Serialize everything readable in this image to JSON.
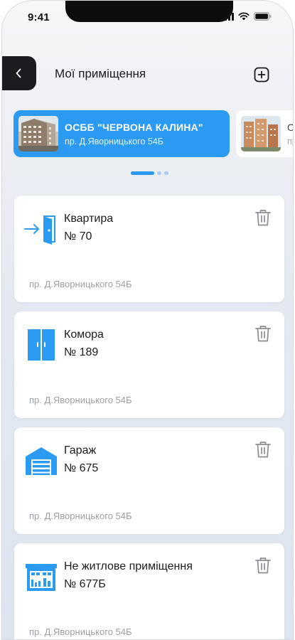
{
  "status_bar": {
    "time": "9:41"
  },
  "header": {
    "title": "Мої приміщення"
  },
  "buildings": [
    {
      "name": "ОСББ \"ЧЕРВОНА КАЛИНА\"",
      "address": "пр. Д.Яворницького 54Б",
      "active": true
    },
    {
      "name": "ОС",
      "address": "пр",
      "active": false
    }
  ],
  "carousel": {
    "pages": 3,
    "current": 1
  },
  "premises": [
    {
      "name": "Квартира",
      "number": "№ 70",
      "address": "пр. Д.Яворницького 54Б",
      "icon": "door-enter-icon"
    },
    {
      "name": "Комора",
      "number": "№ 189",
      "address": "пр. Д.Яворницького 54Б",
      "icon": "storage-closet-icon"
    },
    {
      "name": "Гараж",
      "number": "№ 675",
      "address": "пр. Д.Яворницького 54Б",
      "icon": "garage-icon"
    },
    {
      "name": "Не житлове приміщення",
      "number": "№ 677Б",
      "address": "пр. Д.Яворницького 54Б",
      "icon": "commercial-building-icon"
    }
  ],
  "colors": {
    "accent": "#2a9af3",
    "dark": "#1c1d21"
  }
}
